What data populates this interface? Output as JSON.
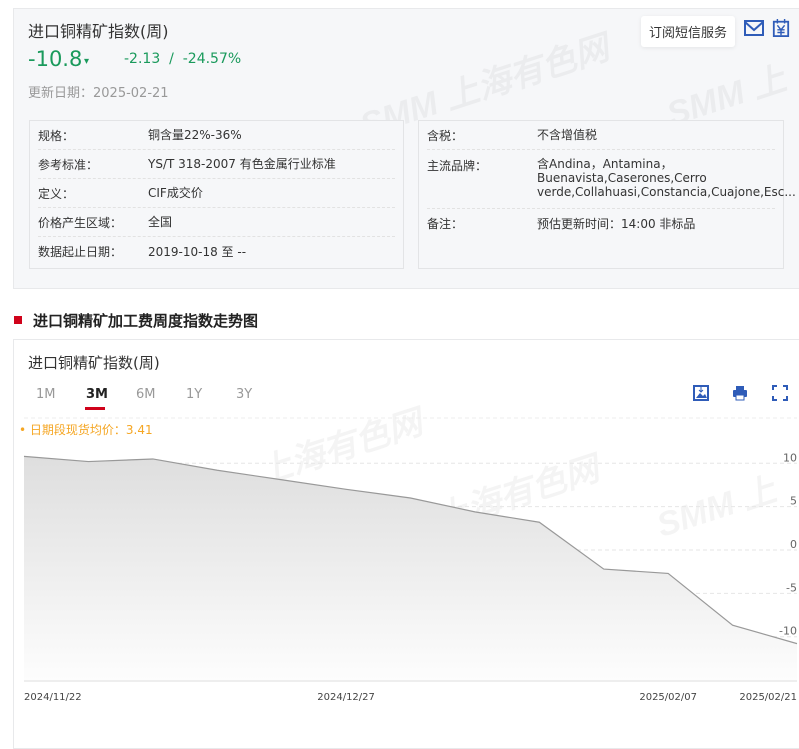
{
  "header": {
    "title": "进口铜精矿指数(周)",
    "value": "-10.8",
    "change": "-2.13  /  -24.57%",
    "updated": "更新日期：2025-02-21",
    "sms_label": "订阅短信服务",
    "icons": [
      "mail-icon",
      "yen-calendar-icon"
    ]
  },
  "watermark": "SMM 上海有色网",
  "specs_left": [
    {
      "k": "规格：",
      "v": "铜含量22%-36%"
    },
    {
      "k": "参考标准：",
      "v": "YS/T 318-2007 有色金属行业标准"
    },
    {
      "k": "定义：",
      "v": "CIF成交价"
    },
    {
      "k": "价格产生区域：",
      "v": "全国"
    },
    {
      "k": "数据起止日期：",
      "v": "2019-10-18 至 --"
    }
  ],
  "specs_right": [
    {
      "k": "含税：",
      "v": "不含增值税"
    },
    {
      "k": "主流品牌：",
      "v": "含Andina，Antamina，Buenavista,Caserones,Cerro verde,Collahuasi,Constancia,Cuajone,Esc..."
    },
    {
      "k": "备注：",
      "v": "预估更新时间：14:00 非标品"
    }
  ],
  "section_title": "进口铜精矿加工费周度指数走势图",
  "chart_panel": {
    "title": "进口铜精矿指数(周)",
    "tabs": [
      "1M",
      "3M",
      "6M",
      "1Y",
      "3Y"
    ],
    "active_tab": "3M",
    "tools": [
      "download-image-icon",
      "print-icon",
      "fullscreen-icon"
    ],
    "avg_label": "• 日期段现货均价：3.41"
  },
  "colors": {
    "up_down": "#1a9a5c",
    "accent": "#d0021b",
    "avg": "#f5a623",
    "icon": "#2f5cb8"
  },
  "chart_data": {
    "type": "area",
    "x": [
      "2024/11/22",
      "2024/11/29",
      "2024/12/06",
      "2024/12/13",
      "2024/12/20",
      "2024/12/27",
      "2025/01/03",
      "2025/01/10",
      "2025/01/17",
      "2025/01/24",
      "2025/02/07",
      "2025/02/14",
      "2025/02/21"
    ],
    "values": [
      10.8,
      10.2,
      10.5,
      9.2,
      8.1,
      7.0,
      6.0,
      4.4,
      3.2,
      -2.2,
      -2.7,
      -8.67,
      -10.8
    ],
    "x_tick_labels": [
      "2024/11/22",
      "2024/12/27",
      "2025/02/07",
      "2025/02/21"
    ],
    "y_ticks": [
      10,
      5,
      0,
      -5,
      -10,
      -15
    ],
    "ylim": [
      -15,
      10
    ],
    "y_axis": "right",
    "grid": true
  }
}
